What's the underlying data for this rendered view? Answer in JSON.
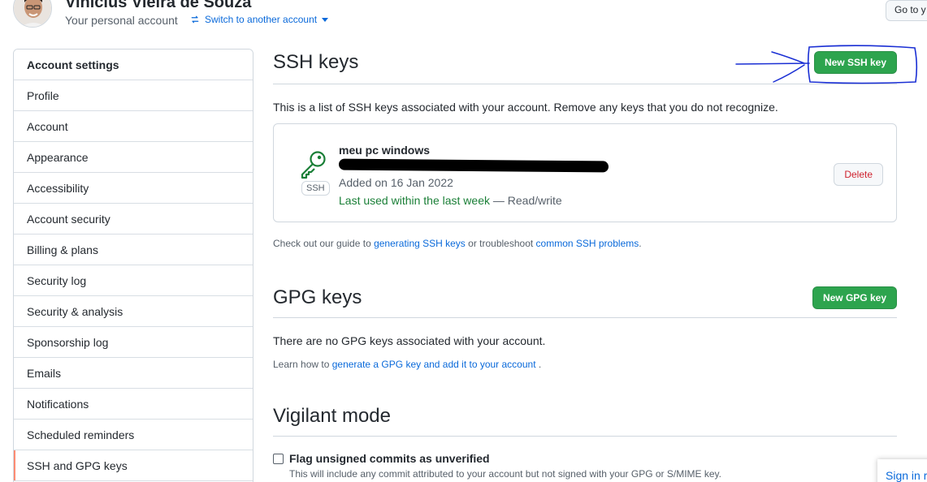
{
  "header": {
    "user_name": "Vinicius Vieira de Souza",
    "subtitle": "Your personal account",
    "switch_account": "Switch to another account",
    "goto_button": "Go to y"
  },
  "sidebar": {
    "heading": "Account settings",
    "items": [
      {
        "label": "Profile",
        "selected": false
      },
      {
        "label": "Account",
        "selected": false
      },
      {
        "label": "Appearance",
        "selected": false
      },
      {
        "label": "Accessibility",
        "selected": false
      },
      {
        "label": "Account security",
        "selected": false
      },
      {
        "label": "Billing & plans",
        "selected": false
      },
      {
        "label": "Security log",
        "selected": false
      },
      {
        "label": "Security & analysis",
        "selected": false
      },
      {
        "label": "Sponsorship log",
        "selected": false
      },
      {
        "label": "Emails",
        "selected": false
      },
      {
        "label": "Notifications",
        "selected": false
      },
      {
        "label": "Scheduled reminders",
        "selected": false
      },
      {
        "label": "SSH and GPG keys",
        "selected": true
      }
    ]
  },
  "ssh": {
    "title": "SSH keys",
    "new_button": "New SSH key",
    "description": "This is a list of SSH keys associated with your account. Remove any keys that you do not recognize.",
    "key": {
      "name": "meu pc windows",
      "badge": "SSH",
      "added": "Added on 16 Jan 2022",
      "last_used": "Last used within the last week",
      "access": " — Read/write",
      "delete_button": "Delete"
    },
    "guide": {
      "prefix": "Check out our guide to ",
      "link1": "generating SSH keys",
      "middle": " or troubleshoot ",
      "link2": "common SSH problems",
      "suffix": "."
    }
  },
  "gpg": {
    "title": "GPG keys",
    "new_button": "New GPG key",
    "empty_text": "There are no GPG keys associated with your account.",
    "learn": {
      "prefix": "Learn how to ",
      "link": "generate a GPG key and add it to your account",
      "suffix": " ."
    }
  },
  "vigilant": {
    "title": "Vigilant mode",
    "checkbox_label": "Flag unsigned commits as unverified",
    "checkbox_checked": false,
    "checkbox_note": "This will include any commit attributed to your account but not signed with your GPG or S/MIME key."
  },
  "signin": "Sign in r",
  "colors": {
    "primary_green": "#2da44e",
    "link_blue": "#0969da",
    "danger_red": "#cf222e",
    "selected_accent": "#fd8c73",
    "annotation_blue": "#1a2fd4"
  }
}
